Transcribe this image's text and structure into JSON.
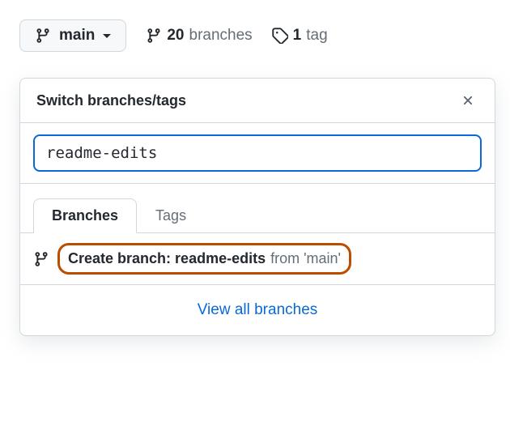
{
  "branch_button": {
    "label": "main"
  },
  "stats": {
    "branches_count": "20",
    "branches_label": "branches",
    "tags_count": "1",
    "tags_label": "tag"
  },
  "popover": {
    "title": "Switch branches/tags",
    "search_value": "readme-edits",
    "tabs": {
      "branches": "Branches",
      "tags": "Tags"
    },
    "create_prefix": "Create branch: ",
    "create_name": "readme-edits",
    "create_from": "from 'main'",
    "view_all": "View all branches"
  }
}
